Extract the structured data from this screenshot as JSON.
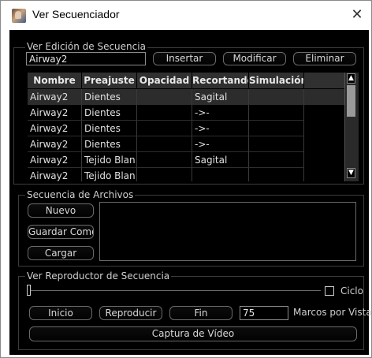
{
  "window": {
    "title": "Ver Secuenciador",
    "close_glyph": "✕"
  },
  "edit": {
    "legend": "Ver Edición de Secuencia",
    "name_value": "Airway2",
    "insert_label": "Insertar",
    "modify_label": "Modificar",
    "delete_label": "Eliminar",
    "table": {
      "headers": [
        "Nombre",
        "Preajuste",
        "Opacidad",
        "Recortando",
        "Simulación"
      ],
      "rows": [
        [
          "Airway2",
          "Dientes",
          "",
          "Sagital",
          ""
        ],
        [
          "Airway2",
          "Dientes",
          "",
          "->-",
          ""
        ],
        [
          "Airway2",
          "Dientes",
          "",
          "->-",
          ""
        ],
        [
          "Airway2",
          "Dientes",
          "",
          "->-",
          ""
        ],
        [
          "Airway2",
          "Tejido Blan...",
          "",
          "Sagital",
          ""
        ],
        [
          "Airway2",
          "Tejido Blan...",
          "",
          "",
          ""
        ]
      ],
      "selected_row": 0
    }
  },
  "files": {
    "legend": "Secuencia de Archivos",
    "new_label": "Nuevo",
    "save_as_label": "Guardar Como",
    "load_label": "Cargar"
  },
  "player": {
    "legend": "Ver Reproductor de Secuencia",
    "position_fraction": 0,
    "cycle_label": "Ciclo",
    "cycle_checked": false,
    "start_label": "Inicio",
    "play_label": "Reproducir",
    "end_label": "Fin",
    "frames_value": "75",
    "frames_label": "Marcos por Vista",
    "capture_label": "Captura de Vídeo"
  },
  "colors": {
    "background": "#000000",
    "header": "#303030",
    "selected_row": "#2c2c2c",
    "text": "#d8d8d8"
  }
}
